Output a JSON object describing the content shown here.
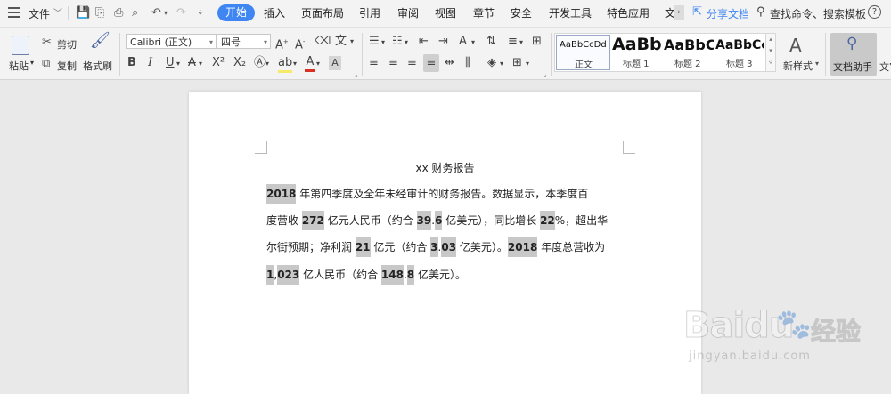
{
  "menubar": {
    "file_label": "文件",
    "tabs": [
      "开始",
      "插入",
      "页面布局",
      "引用",
      "审阅",
      "视图",
      "章节",
      "安全",
      "开发工具",
      "特色应用",
      "文"
    ],
    "active_tab_index": 0,
    "share_label": "分享文档",
    "search_label": "查找命令、搜索模板",
    "help_label": "?"
  },
  "ribbon": {
    "paste_label": "粘贴",
    "cut_label": "剪切",
    "copy_label": "复制",
    "format_painter_label": "格式刷",
    "font_name": "Calibri (正文)",
    "font_size": "四号",
    "bold_label": "B",
    "italic_label": "I",
    "underline_label": "U",
    "font_color_label": "A",
    "styles": [
      {
        "sample": "AaBbCcDd",
        "name": "正文"
      },
      {
        "sample": "AaBb",
        "name": "标题 1"
      },
      {
        "sample": "AaBbC",
        "name": "标题 2"
      },
      {
        "sample": "AaBbCc",
        "name": "标题 3"
      }
    ],
    "new_style_label": "新样式",
    "doc_assistant_label": "文档助手",
    "doc_tools_label": "文字"
  },
  "document": {
    "title": "xx 财务报告",
    "lines": [
      [
        [
          "2018",
          true
        ],
        [
          " 年第四季度及全年未经审计的财务报告。数据显示，本季度百",
          false
        ]
      ],
      [
        [
          "度营收 ",
          false
        ],
        [
          "272",
          true
        ],
        [
          " 亿元人民币（约合 ",
          false
        ],
        [
          "39",
          true
        ],
        [
          ".",
          false
        ],
        [
          "6",
          true
        ],
        [
          " 亿美元），同比增长 ",
          false
        ],
        [
          "22",
          true
        ],
        [
          "%，超出华",
          false
        ]
      ],
      [
        [
          "尔街预期；净利润 ",
          false
        ],
        [
          "21",
          true
        ],
        [
          " 亿元（约合 ",
          false
        ],
        [
          "3",
          true
        ],
        [
          ".",
          false
        ],
        [
          "03",
          true
        ],
        [
          " 亿美元）。",
          false
        ],
        [
          "2018",
          true
        ],
        [
          " 年度总营收为",
          false
        ]
      ],
      [
        [
          "1",
          true
        ],
        [
          ",",
          false
        ],
        [
          "023",
          true
        ],
        [
          " 亿人民币（约合 ",
          false
        ],
        [
          "148",
          true
        ],
        [
          ".",
          false
        ],
        [
          "8",
          true
        ],
        [
          " 亿美元）。",
          false
        ]
      ]
    ]
  },
  "watermark": {
    "brand": "Baidu",
    "brand_cn": "经验",
    "url": "jingyan.baidu.com"
  }
}
